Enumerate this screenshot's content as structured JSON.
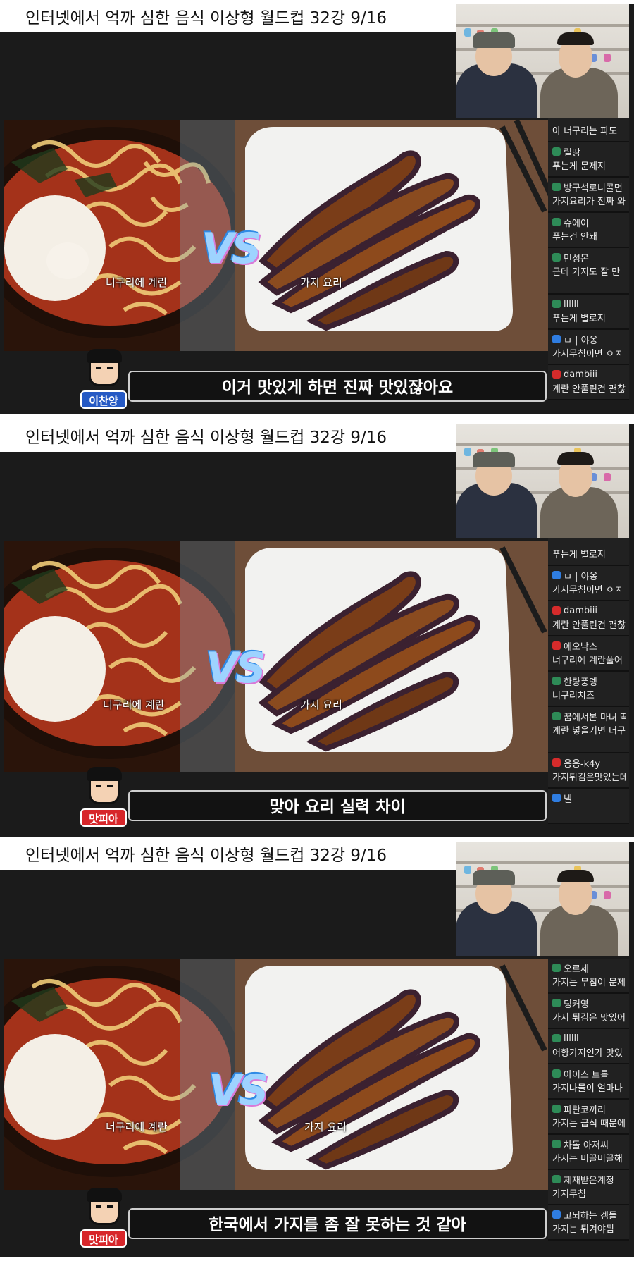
{
  "colors": {
    "chat_badge_green": "#2e8b57",
    "chat_badge_blue": "#2f7de1",
    "chat_badge_red": "#d62b2b",
    "tag_blue": "#2559c4",
    "tag_red": "#d7262a"
  },
  "panels": [
    {
      "title": "인터넷에서 억까 심한 음식 이상형 월드컵   32강   9/16",
      "left_label": "너구리에 계란",
      "right_label": "가지 요리",
      "vs_text": "VS",
      "subtitle": "이거 맛있게 하면 진짜 맛있잖아요",
      "speaker": "이찬양",
      "speaker_color": "#2559c4",
      "chat": [
        {
          "name": "",
          "msg": "아 너구리는 파도",
          "badge": "#2e8b57"
        },
        {
          "name": "릴땅",
          "msg": "푸는게 문제지",
          "badge": "#2e8b57"
        },
        {
          "name": "방구석로니콜먼",
          "msg": "가지요리가 진짜 와",
          "badge": "#2e8b57"
        },
        {
          "name": "슈에이",
          "msg": "푸는건 안돼",
          "badge": "#2e8b57"
        },
        {
          "name": "민성몬",
          "msg": "근데 가지도 잘 만",
          "badge": "#2e8b57"
        },
        {
          "name": "llllll",
          "msg": "푸는게 별로지",
          "badge": "#2e8b57"
        },
        {
          "name": "ㅁ | 야옹",
          "msg": "가지무침이면 ㅇㅈ",
          "badge": "#2f7de1"
        },
        {
          "name": "dambiii",
          "msg": "계란 안풀린건 괜찮",
          "badge": "#d62b2b"
        }
      ]
    },
    {
      "title": "인터넷에서 억까 심한 음식 이상형 월드컵   32강   9/16",
      "left_label": "너구리에 계란",
      "right_label": "가지 요리",
      "vs_text": "VS",
      "subtitle": "맞아 요리 실력 차이",
      "speaker": "맛피아",
      "speaker_color": "#d7262a",
      "chat": [
        {
          "name": "",
          "msg": "푸는게 별로지",
          "badge": "#2e8b57"
        },
        {
          "name": "ㅁ | 야옹",
          "msg": "가지무침이면 ㅇㅈ",
          "badge": "#2f7de1"
        },
        {
          "name": "dambiii",
          "msg": "계란 안풀린건 괜찮",
          "badge": "#d62b2b"
        },
        {
          "name": "에오낙스",
          "msg": "너구리에 계란풀어",
          "badge": "#d62b2b"
        },
        {
          "name": "한량풍뎅",
          "msg": "너구리치즈",
          "badge": "#2e8b57"
        },
        {
          "name": "꿈에서본 마녀 떡",
          "msg": "계란 넣을거면 너구",
          "badge": "#2e8b57"
        },
        {
          "name": "응응-k4y",
          "msg": "가지튀김은맛있는데",
          "badge": "#d62b2b"
        },
        {
          "name": "넬",
          "msg": "",
          "badge": "#2f7de1"
        }
      ]
    },
    {
      "title": "인터넷에서 억까 심한 음식 이상형 월드컵   32강   9/16",
      "left_label": "너구리에 계란",
      "right_label": "가지 요리",
      "vs_text": "VS",
      "subtitle": "한국에서 가지를 좀 잘 못하는 것 같아",
      "speaker": "맛피아",
      "speaker_color": "#d7262a",
      "chat": [
        {
          "name": "오르세",
          "msg": "가지는 무침이 문제",
          "badge": "#2e8b57"
        },
        {
          "name": "팅커영",
          "msg": "가지 튀김은 맛있어",
          "badge": "#2e8b57"
        },
        {
          "name": "llllll",
          "msg": "어향가지인가 맛있",
          "badge": "#2e8b57"
        },
        {
          "name": "아이스 트롤",
          "msg": "가지나물이 얼마나",
          "badge": "#2e8b57"
        },
        {
          "name": "파란코끼리",
          "msg": "가지는 급식 때문에",
          "badge": "#2e8b57"
        },
        {
          "name": "차돌 아저씨",
          "msg": "가지는 미끌미끌해",
          "badge": "#2e8b57"
        },
        {
          "name": "제재받은계정",
          "msg": "가지무침",
          "badge": "#2e8b57"
        },
        {
          "name": "고뇌하는 겜돌",
          "msg": "가지는 튀겨야됨",
          "badge": "#2f7de1"
        }
      ]
    }
  ]
}
